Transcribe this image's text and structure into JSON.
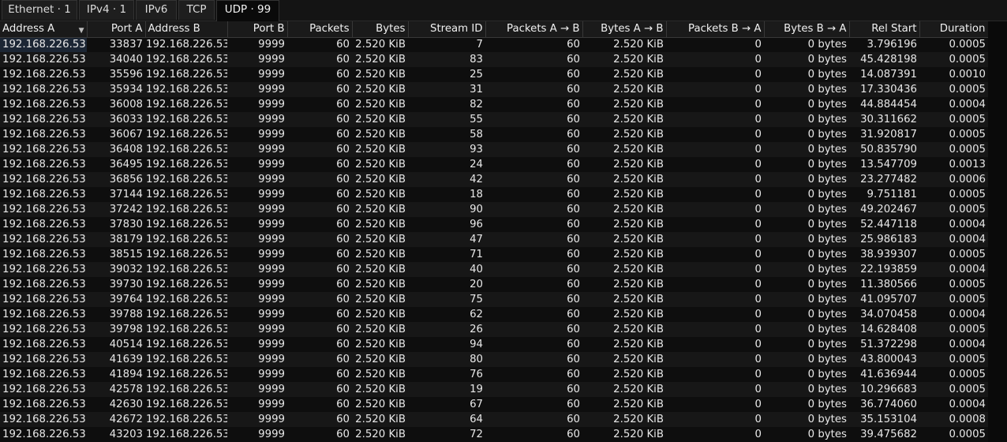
{
  "tabs": [
    {
      "label": "Ethernet · 1"
    },
    {
      "label": "IPv4 · 1"
    },
    {
      "label": "IPv6"
    },
    {
      "label": "TCP"
    },
    {
      "label": "UDP · 99"
    }
  ],
  "active_tab": 4,
  "columns": [
    "Address A",
    "Port A",
    "Address B",
    "Port B",
    "Packets",
    "Bytes",
    "Stream ID",
    "Packets A → B",
    "Bytes A → B",
    "Packets B → A",
    "Bytes B → A",
    "Rel Start",
    "Duration"
  ],
  "sort_column": "Address A",
  "rows": [
    [
      "192.168.226.53",
      "33837",
      "192.168.226.53",
      "9999",
      "60",
      "2.520 KiB",
      "7",
      "60",
      "2.520 KiB",
      "0",
      "0 bytes",
      "3.796196",
      "0.0005"
    ],
    [
      "192.168.226.53",
      "34040",
      "192.168.226.53",
      "9999",
      "60",
      "2.520 KiB",
      "83",
      "60",
      "2.520 KiB",
      "0",
      "0 bytes",
      "45.428198",
      "0.0005"
    ],
    [
      "192.168.226.53",
      "35596",
      "192.168.226.53",
      "9999",
      "60",
      "2.520 KiB",
      "25",
      "60",
      "2.520 KiB",
      "0",
      "0 bytes",
      "14.087391",
      "0.0010"
    ],
    [
      "192.168.226.53",
      "35934",
      "192.168.226.53",
      "9999",
      "60",
      "2.520 KiB",
      "31",
      "60",
      "2.520 KiB",
      "0",
      "0 bytes",
      "17.330436",
      "0.0005"
    ],
    [
      "192.168.226.53",
      "36008",
      "192.168.226.53",
      "9999",
      "60",
      "2.520 KiB",
      "82",
      "60",
      "2.520 KiB",
      "0",
      "0 bytes",
      "44.884454",
      "0.0004"
    ],
    [
      "192.168.226.53",
      "36033",
      "192.168.226.53",
      "9999",
      "60",
      "2.520 KiB",
      "55",
      "60",
      "2.520 KiB",
      "0",
      "0 bytes",
      "30.311662",
      "0.0005"
    ],
    [
      "192.168.226.53",
      "36067",
      "192.168.226.53",
      "9999",
      "60",
      "2.520 KiB",
      "58",
      "60",
      "2.520 KiB",
      "0",
      "0 bytes",
      "31.920817",
      "0.0005"
    ],
    [
      "192.168.226.53",
      "36408",
      "192.168.226.53",
      "9999",
      "60",
      "2.520 KiB",
      "93",
      "60",
      "2.520 KiB",
      "0",
      "0 bytes",
      "50.835790",
      "0.0005"
    ],
    [
      "192.168.226.53",
      "36495",
      "192.168.226.53",
      "9999",
      "60",
      "2.520 KiB",
      "24",
      "60",
      "2.520 KiB",
      "0",
      "0 bytes",
      "13.547709",
      "0.0013"
    ],
    [
      "192.168.226.53",
      "36856",
      "192.168.226.53",
      "9999",
      "60",
      "2.520 KiB",
      "42",
      "60",
      "2.520 KiB",
      "0",
      "0 bytes",
      "23.277482",
      "0.0006"
    ],
    [
      "192.168.226.53",
      "37144",
      "192.168.226.53",
      "9999",
      "60",
      "2.520 KiB",
      "18",
      "60",
      "2.520 KiB",
      "0",
      "0 bytes",
      "9.751181",
      "0.0005"
    ],
    [
      "192.168.226.53",
      "37242",
      "192.168.226.53",
      "9999",
      "60",
      "2.520 KiB",
      "90",
      "60",
      "2.520 KiB",
      "0",
      "0 bytes",
      "49.202467",
      "0.0005"
    ],
    [
      "192.168.226.53",
      "37830",
      "192.168.226.53",
      "9999",
      "60",
      "2.520 KiB",
      "96",
      "60",
      "2.520 KiB",
      "0",
      "0 bytes",
      "52.447118",
      "0.0004"
    ],
    [
      "192.168.226.53",
      "38179",
      "192.168.226.53",
      "9999",
      "60",
      "2.520 KiB",
      "47",
      "60",
      "2.520 KiB",
      "0",
      "0 bytes",
      "25.986183",
      "0.0004"
    ],
    [
      "192.168.226.53",
      "38515",
      "192.168.226.53",
      "9999",
      "60",
      "2.520 KiB",
      "71",
      "60",
      "2.520 KiB",
      "0",
      "0 bytes",
      "38.939307",
      "0.0005"
    ],
    [
      "192.168.226.53",
      "39032",
      "192.168.226.53",
      "9999",
      "60",
      "2.520 KiB",
      "40",
      "60",
      "2.520 KiB",
      "0",
      "0 bytes",
      "22.193859",
      "0.0004"
    ],
    [
      "192.168.226.53",
      "39730",
      "192.168.226.53",
      "9999",
      "60",
      "2.520 KiB",
      "20",
      "60",
      "2.520 KiB",
      "0",
      "0 bytes",
      "11.380566",
      "0.0005"
    ],
    [
      "192.168.226.53",
      "39764",
      "192.168.226.53",
      "9999",
      "60",
      "2.520 KiB",
      "75",
      "60",
      "2.520 KiB",
      "0",
      "0 bytes",
      "41.095707",
      "0.0005"
    ],
    [
      "192.168.226.53",
      "39788",
      "192.168.226.53",
      "9999",
      "60",
      "2.520 KiB",
      "62",
      "60",
      "2.520 KiB",
      "0",
      "0 bytes",
      "34.070458",
      "0.0004"
    ],
    [
      "192.168.226.53",
      "39798",
      "192.168.226.53",
      "9999",
      "60",
      "2.520 KiB",
      "26",
      "60",
      "2.520 KiB",
      "0",
      "0 bytes",
      "14.628408",
      "0.0005"
    ],
    [
      "192.168.226.53",
      "40514",
      "192.168.226.53",
      "9999",
      "60",
      "2.520 KiB",
      "94",
      "60",
      "2.520 KiB",
      "0",
      "0 bytes",
      "51.372298",
      "0.0004"
    ],
    [
      "192.168.226.53",
      "41639",
      "192.168.226.53",
      "9999",
      "60",
      "2.520 KiB",
      "80",
      "60",
      "2.520 KiB",
      "0",
      "0 bytes",
      "43.800043",
      "0.0005"
    ],
    [
      "192.168.226.53",
      "41894",
      "192.168.226.53",
      "9999",
      "60",
      "2.520 KiB",
      "76",
      "60",
      "2.520 KiB",
      "0",
      "0 bytes",
      "41.636944",
      "0.0005"
    ],
    [
      "192.168.226.53",
      "42578",
      "192.168.226.53",
      "9999",
      "60",
      "2.520 KiB",
      "19",
      "60",
      "2.520 KiB",
      "0",
      "0 bytes",
      "10.296683",
      "0.0005"
    ],
    [
      "192.168.226.53",
      "42630",
      "192.168.226.53",
      "9999",
      "60",
      "2.520 KiB",
      "67",
      "60",
      "2.520 KiB",
      "0",
      "0 bytes",
      "36.774060",
      "0.0004"
    ],
    [
      "192.168.226.53",
      "42672",
      "192.168.226.53",
      "9999",
      "60",
      "2.520 KiB",
      "64",
      "60",
      "2.520 KiB",
      "0",
      "0 bytes",
      "35.153104",
      "0.0008"
    ],
    [
      "192.168.226.53",
      "43203",
      "192.168.226.53",
      "9999",
      "60",
      "2.520 KiB",
      "72",
      "60",
      "2.520 KiB",
      "0",
      "0 bytes",
      "39.475682",
      "0.0005"
    ]
  ]
}
